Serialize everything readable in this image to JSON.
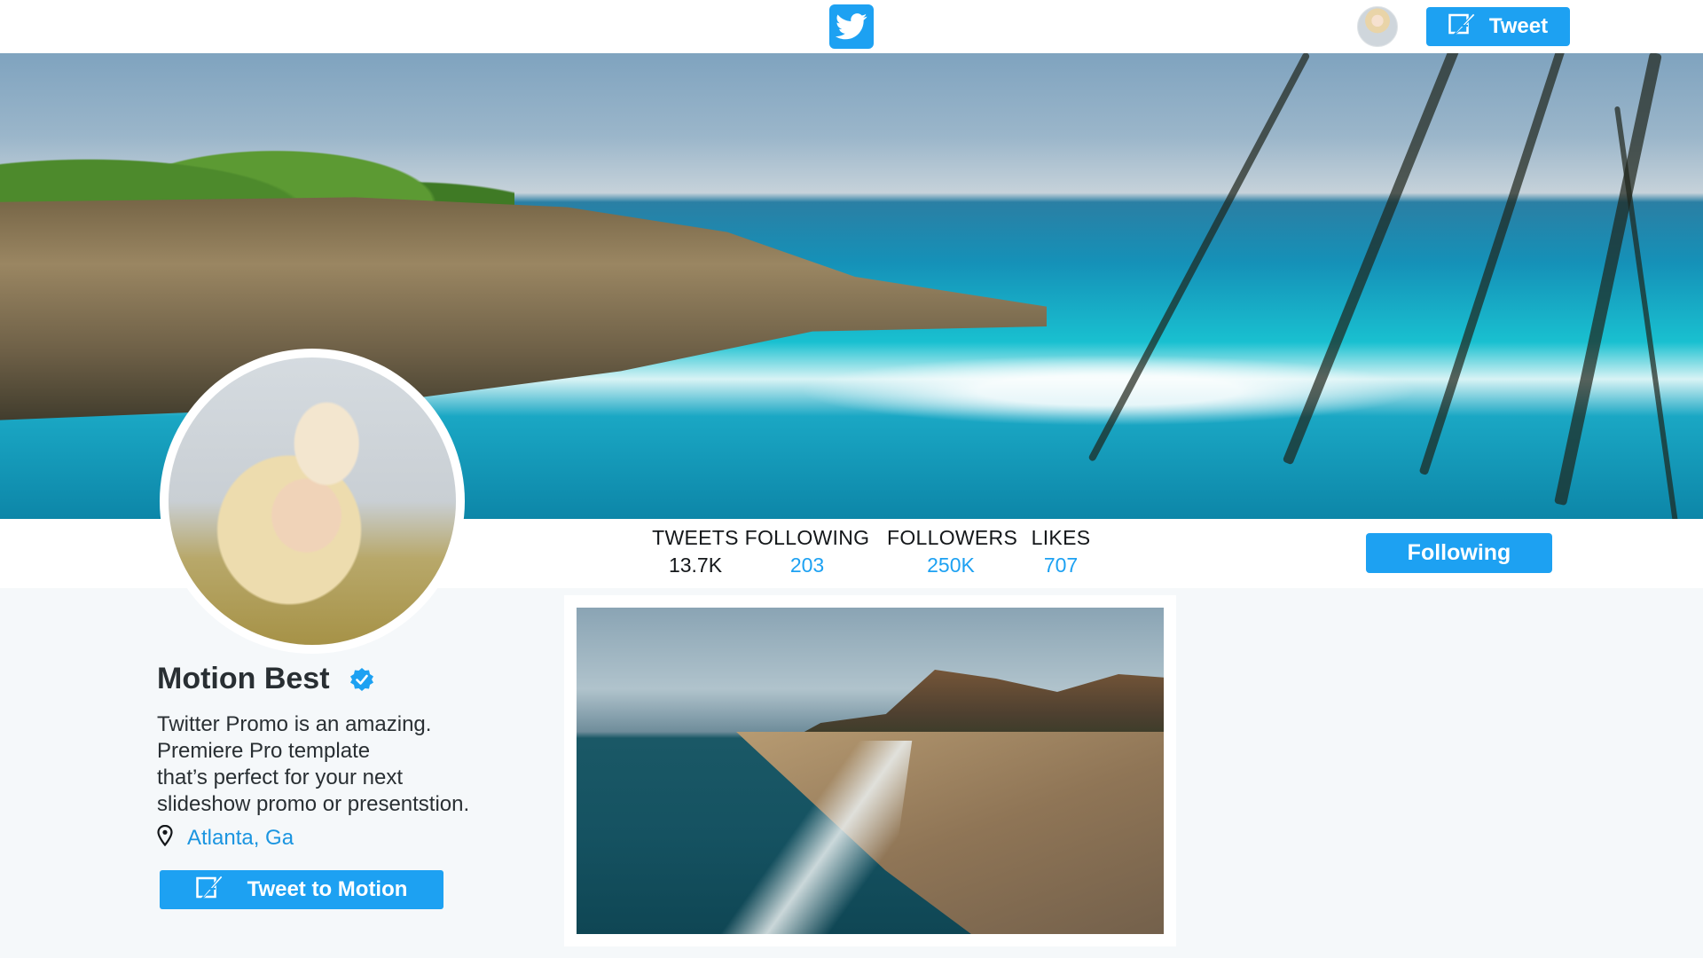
{
  "topbar": {
    "logo_icon": "twitter-bird-icon",
    "tweet_label": "Tweet",
    "tweet_icon": "compose-quill-icon"
  },
  "stats": [
    {
      "label": "TWEETS",
      "value": "13.7K",
      "color": "#14171a"
    },
    {
      "label": "FOLLOWING",
      "value": "203",
      "color": "#1da1f2"
    },
    {
      "label": "FOLLOWERS",
      "value": "250K",
      "color": "#1da1f2"
    },
    {
      "label": "LIKES",
      "value": "707",
      "color": "#1da1f2"
    }
  ],
  "follow_button": {
    "label": "Following"
  },
  "profile": {
    "name": "Motion Best",
    "verified_icon": "verified-badge-icon",
    "bio_lines": [
      "Twitter Promo is an amazing.",
      "Premiere Pro template",
      "that’s perfect for your next",
      "slideshow promo or presentstion."
    ],
    "location_icon": "location-pin-icon",
    "location": "Atlanta, Ga",
    "tweet_to_label": "Tweet to Motion"
  },
  "colors": {
    "accent": "#1da1f2",
    "link": "#1b95e0",
    "background": "#f5f8fa"
  }
}
